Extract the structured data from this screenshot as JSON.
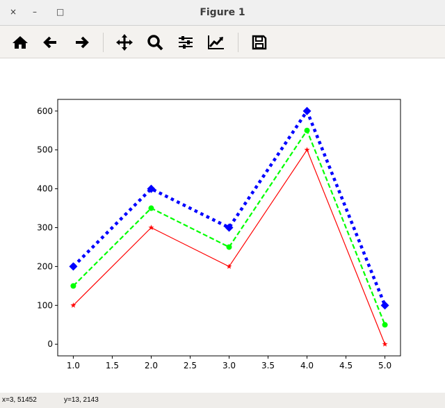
{
  "window": {
    "title": "Figure 1",
    "close": "×",
    "minimize": "–",
    "maximize": "□"
  },
  "toolbar": [
    "home-icon",
    "back-icon",
    "forward-icon",
    "pan-icon",
    "zoom-icon",
    "configure-subplots-icon",
    "edit-axes-icon",
    "save-icon"
  ],
  "status": {
    "x": "x=3, 51452",
    "y": "y=13, 2143"
  },
  "chart_data": {
    "type": "line",
    "x": [
      1,
      2,
      3,
      4,
      5
    ],
    "series": [
      {
        "name": "red",
        "values": [
          100,
          300,
          200,
          500,
          0
        ],
        "color": "#ff0000",
        "style": "solid",
        "marker": "star"
      },
      {
        "name": "green",
        "values": [
          150,
          350,
          250,
          550,
          50
        ],
        "color": "#00ff00",
        "style": "dashed",
        "marker": "circle"
      },
      {
        "name": "blue",
        "values": [
          200,
          400,
          300,
          600,
          100
        ],
        "color": "#0000ff",
        "style": "dotted",
        "marker": "diamond"
      }
    ],
    "xticks": [
      "1.0",
      "1.5",
      "2.0",
      "2.5",
      "3.0",
      "3.5",
      "4.0",
      "4.5",
      "5.0"
    ],
    "yticks": [
      "0",
      "100",
      "200",
      "300",
      "400",
      "500",
      "600"
    ],
    "xlim": [
      0.8,
      5.2
    ],
    "ylim": [
      -30,
      630
    ],
    "title": "",
    "xlabel": "",
    "ylabel": "",
    "grid": false
  }
}
